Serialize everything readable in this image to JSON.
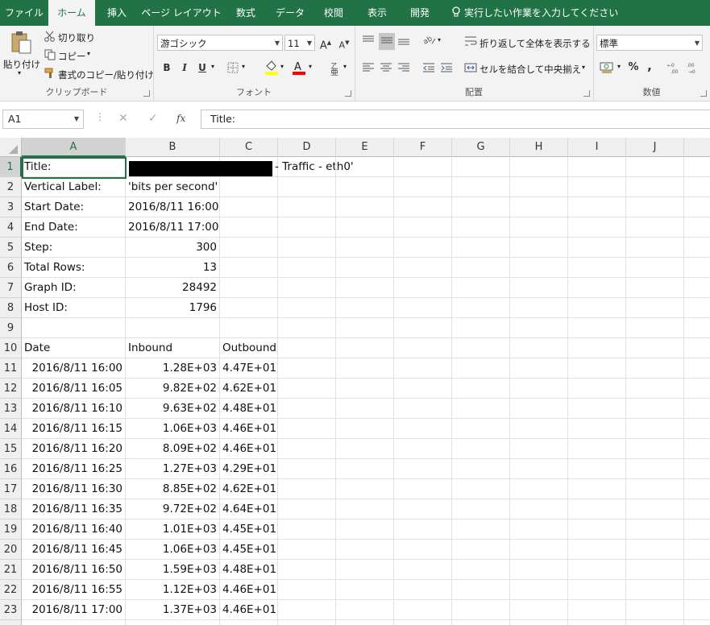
{
  "tabs": [
    "ファイル",
    "ホーム",
    "挿入",
    "ページ レイアウト",
    "数式",
    "データ",
    "校閲",
    "表示",
    "開発"
  ],
  "tell_me": "実行したい作業を入力してください",
  "ribbon": {
    "clipboard": {
      "paste": "貼り付け",
      "cut": "切り取り",
      "copy": "コピー",
      "format_painter": "書式のコピー/貼り付け",
      "label": "クリップボード"
    },
    "font": {
      "name": "游ゴシック",
      "size": "11",
      "bold": "B",
      "italic": "I",
      "underline": "U",
      "label": "フォント"
    },
    "alignment": {
      "wrap": "折り返して全体を表示する",
      "merge": "セルを結合して中央揃え",
      "label": "配置"
    },
    "number": {
      "format": "標準",
      "percent": "%",
      "comma": ",",
      "label": "数値"
    }
  },
  "formula_bar": {
    "name_box": "A1",
    "fx": "fx",
    "content": "Title:"
  },
  "columns": [
    "A",
    "B",
    "C",
    "D",
    "E",
    "F",
    "G",
    "H",
    "I",
    "J"
  ],
  "selected_cell": "A1",
  "cells": {
    "r1": {
      "a": "Title:",
      "c_suffix": "- Traffic - eth0'"
    },
    "r2": {
      "a": "Vertical Label:",
      "b": "'bits per second'"
    },
    "r3": {
      "a": "Start Date:",
      "b": "2016/8/11 16:00"
    },
    "r4": {
      "a": "End Date:",
      "b": "2016/8/11 17:00"
    },
    "r5": {
      "a": "Step:",
      "b": "300"
    },
    "r6": {
      "a": "Total Rows:",
      "b": "13"
    },
    "r7": {
      "a": "Graph ID:",
      "b": "28492"
    },
    "r8": {
      "a": "Host ID:",
      "b": "1796"
    },
    "r10": {
      "a": "Date",
      "b": "Inbound",
      "c": "Outbound"
    }
  },
  "data_rows": [
    {
      "date": "2016/8/11 16:00",
      "inbound": "1.28E+03",
      "outbound": "4.47E+01"
    },
    {
      "date": "2016/8/11 16:05",
      "inbound": "9.82E+02",
      "outbound": "4.62E+01"
    },
    {
      "date": "2016/8/11 16:10",
      "inbound": "9.63E+02",
      "outbound": "4.48E+01"
    },
    {
      "date": "2016/8/11 16:15",
      "inbound": "1.06E+03",
      "outbound": "4.46E+01"
    },
    {
      "date": "2016/8/11 16:20",
      "inbound": "8.09E+02",
      "outbound": "4.46E+01"
    },
    {
      "date": "2016/8/11 16:25",
      "inbound": "1.27E+03",
      "outbound": "4.29E+01"
    },
    {
      "date": "2016/8/11 16:30",
      "inbound": "8.85E+02",
      "outbound": "4.62E+01"
    },
    {
      "date": "2016/8/11 16:35",
      "inbound": "9.72E+02",
      "outbound": "4.64E+01"
    },
    {
      "date": "2016/8/11 16:40",
      "inbound": "1.01E+03",
      "outbound": "4.45E+01"
    },
    {
      "date": "2016/8/11 16:45",
      "inbound": "1.06E+03",
      "outbound": "4.45E+01"
    },
    {
      "date": "2016/8/11 16:50",
      "inbound": "1.59E+03",
      "outbound": "4.48E+01"
    },
    {
      "date": "2016/8/11 16:55",
      "inbound": "1.12E+03",
      "outbound": "4.46E+01"
    },
    {
      "date": "2016/8/11 17:00",
      "inbound": "1.37E+03",
      "outbound": "4.46E+01"
    }
  ],
  "colors": {
    "accent": "#217346",
    "font_color": "#ff0000",
    "fill_color": "#ffff00"
  }
}
